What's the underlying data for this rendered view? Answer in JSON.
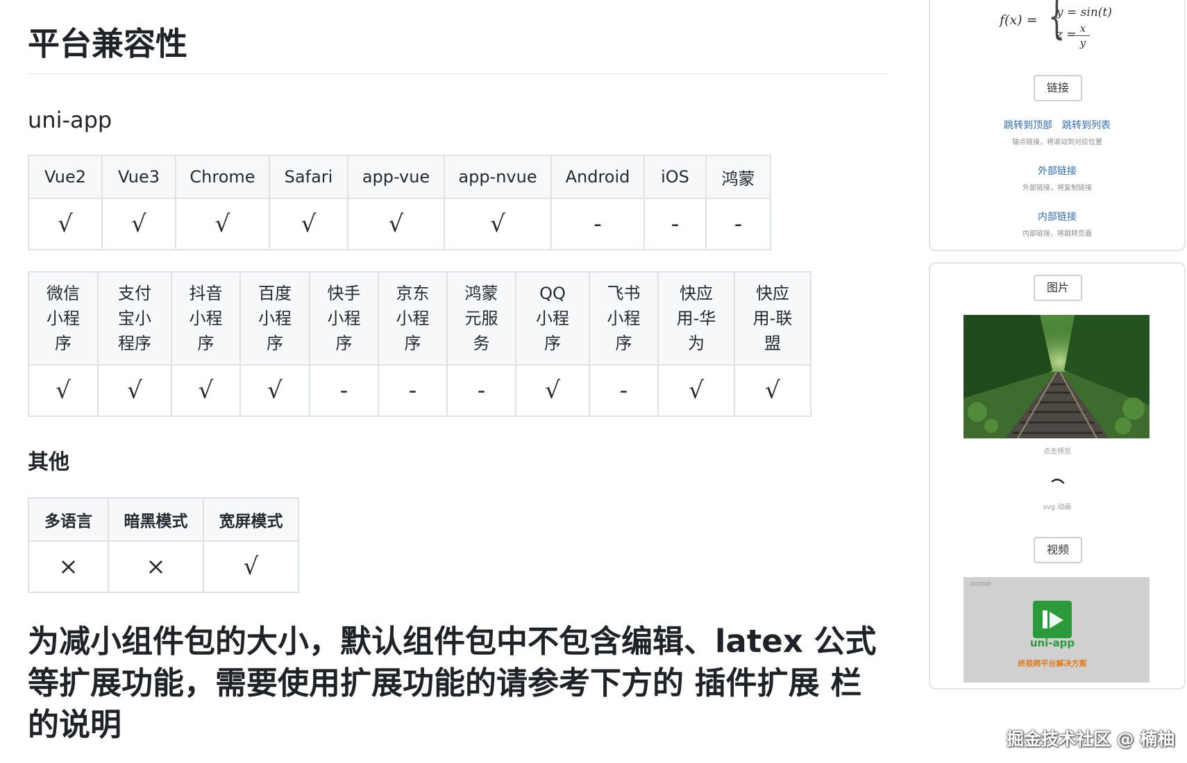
{
  "doc": {
    "title": "平台兼容性",
    "section_uniapp": "uni-app",
    "table1": {
      "headers": [
        "Vue2",
        "Vue3",
        "Chrome",
        "Safari",
        "app-vue",
        "app-nvue",
        "Android",
        "iOS",
        "鸿蒙"
      ],
      "values": [
        "√",
        "√",
        "√",
        "√",
        "√",
        "√",
        "-",
        "-",
        "-"
      ]
    },
    "table2": {
      "headers": [
        [
          "微信",
          "小程",
          "序"
        ],
        [
          "支付",
          "宝小",
          "程序"
        ],
        [
          "抖音",
          "小程",
          "序"
        ],
        [
          "百度",
          "小程",
          "序"
        ],
        [
          "快手",
          "小程",
          "序"
        ],
        [
          "京东",
          "小程",
          "序"
        ],
        [
          "鸿蒙",
          "元服",
          "务"
        ],
        [
          "QQ",
          "小程",
          "序"
        ],
        [
          "飞书",
          "小程",
          "序"
        ],
        [
          "快应",
          "用-华",
          "为"
        ],
        [
          "快应",
          "用-联",
          "盟"
        ]
      ],
      "values": [
        "√",
        "√",
        "√",
        "√",
        "-",
        "-",
        "-",
        "√",
        "-",
        "√",
        "√"
      ]
    },
    "section_other": "其他",
    "table3": {
      "headers": [
        "多语言",
        "暗黑模式",
        "宽屏模式"
      ],
      "values": [
        "×",
        "×",
        "√"
      ]
    },
    "note": "为减小组件包的大小，默认组件包中不包含编辑、latex 公式等扩展功能，需要使用扩展功能的请参考下方的 插件扩展 栏的说明"
  },
  "preview_top": {
    "math": {
      "fx": "f(x) =",
      "line1": "y = sin(t)",
      "line2": "z =",
      "frac_num": "x",
      "frac_den": "y"
    },
    "link_button": "链接",
    "anchor_links": [
      "跳转到顶部",
      "跳转到列表"
    ],
    "anchor_desc": "锚点链接，将滚动到对应位置",
    "external_link": "外部链接",
    "external_desc": "外部链接，将复制链接",
    "internal_link": "内部链接",
    "internal_desc": "内部链接，将跳转页面"
  },
  "preview_bottom": {
    "image_button": "图片",
    "image_caption": "点击预览",
    "svg_caption": "svg 动画",
    "video_button": "视频",
    "video": {
      "brand": "DCLOUD",
      "name": "uni-app",
      "slogan": "终极跨平台解决方案"
    }
  },
  "watermark": "掘金技术社区 @ 楠柚",
  "colors": {
    "link": "#2f6ab6",
    "table_border": "#dfe2e5",
    "table_header_bg": "#f6f8fa",
    "uniapp_green": "#2b9a3b",
    "uniapp_orange": "#e07a18"
  }
}
